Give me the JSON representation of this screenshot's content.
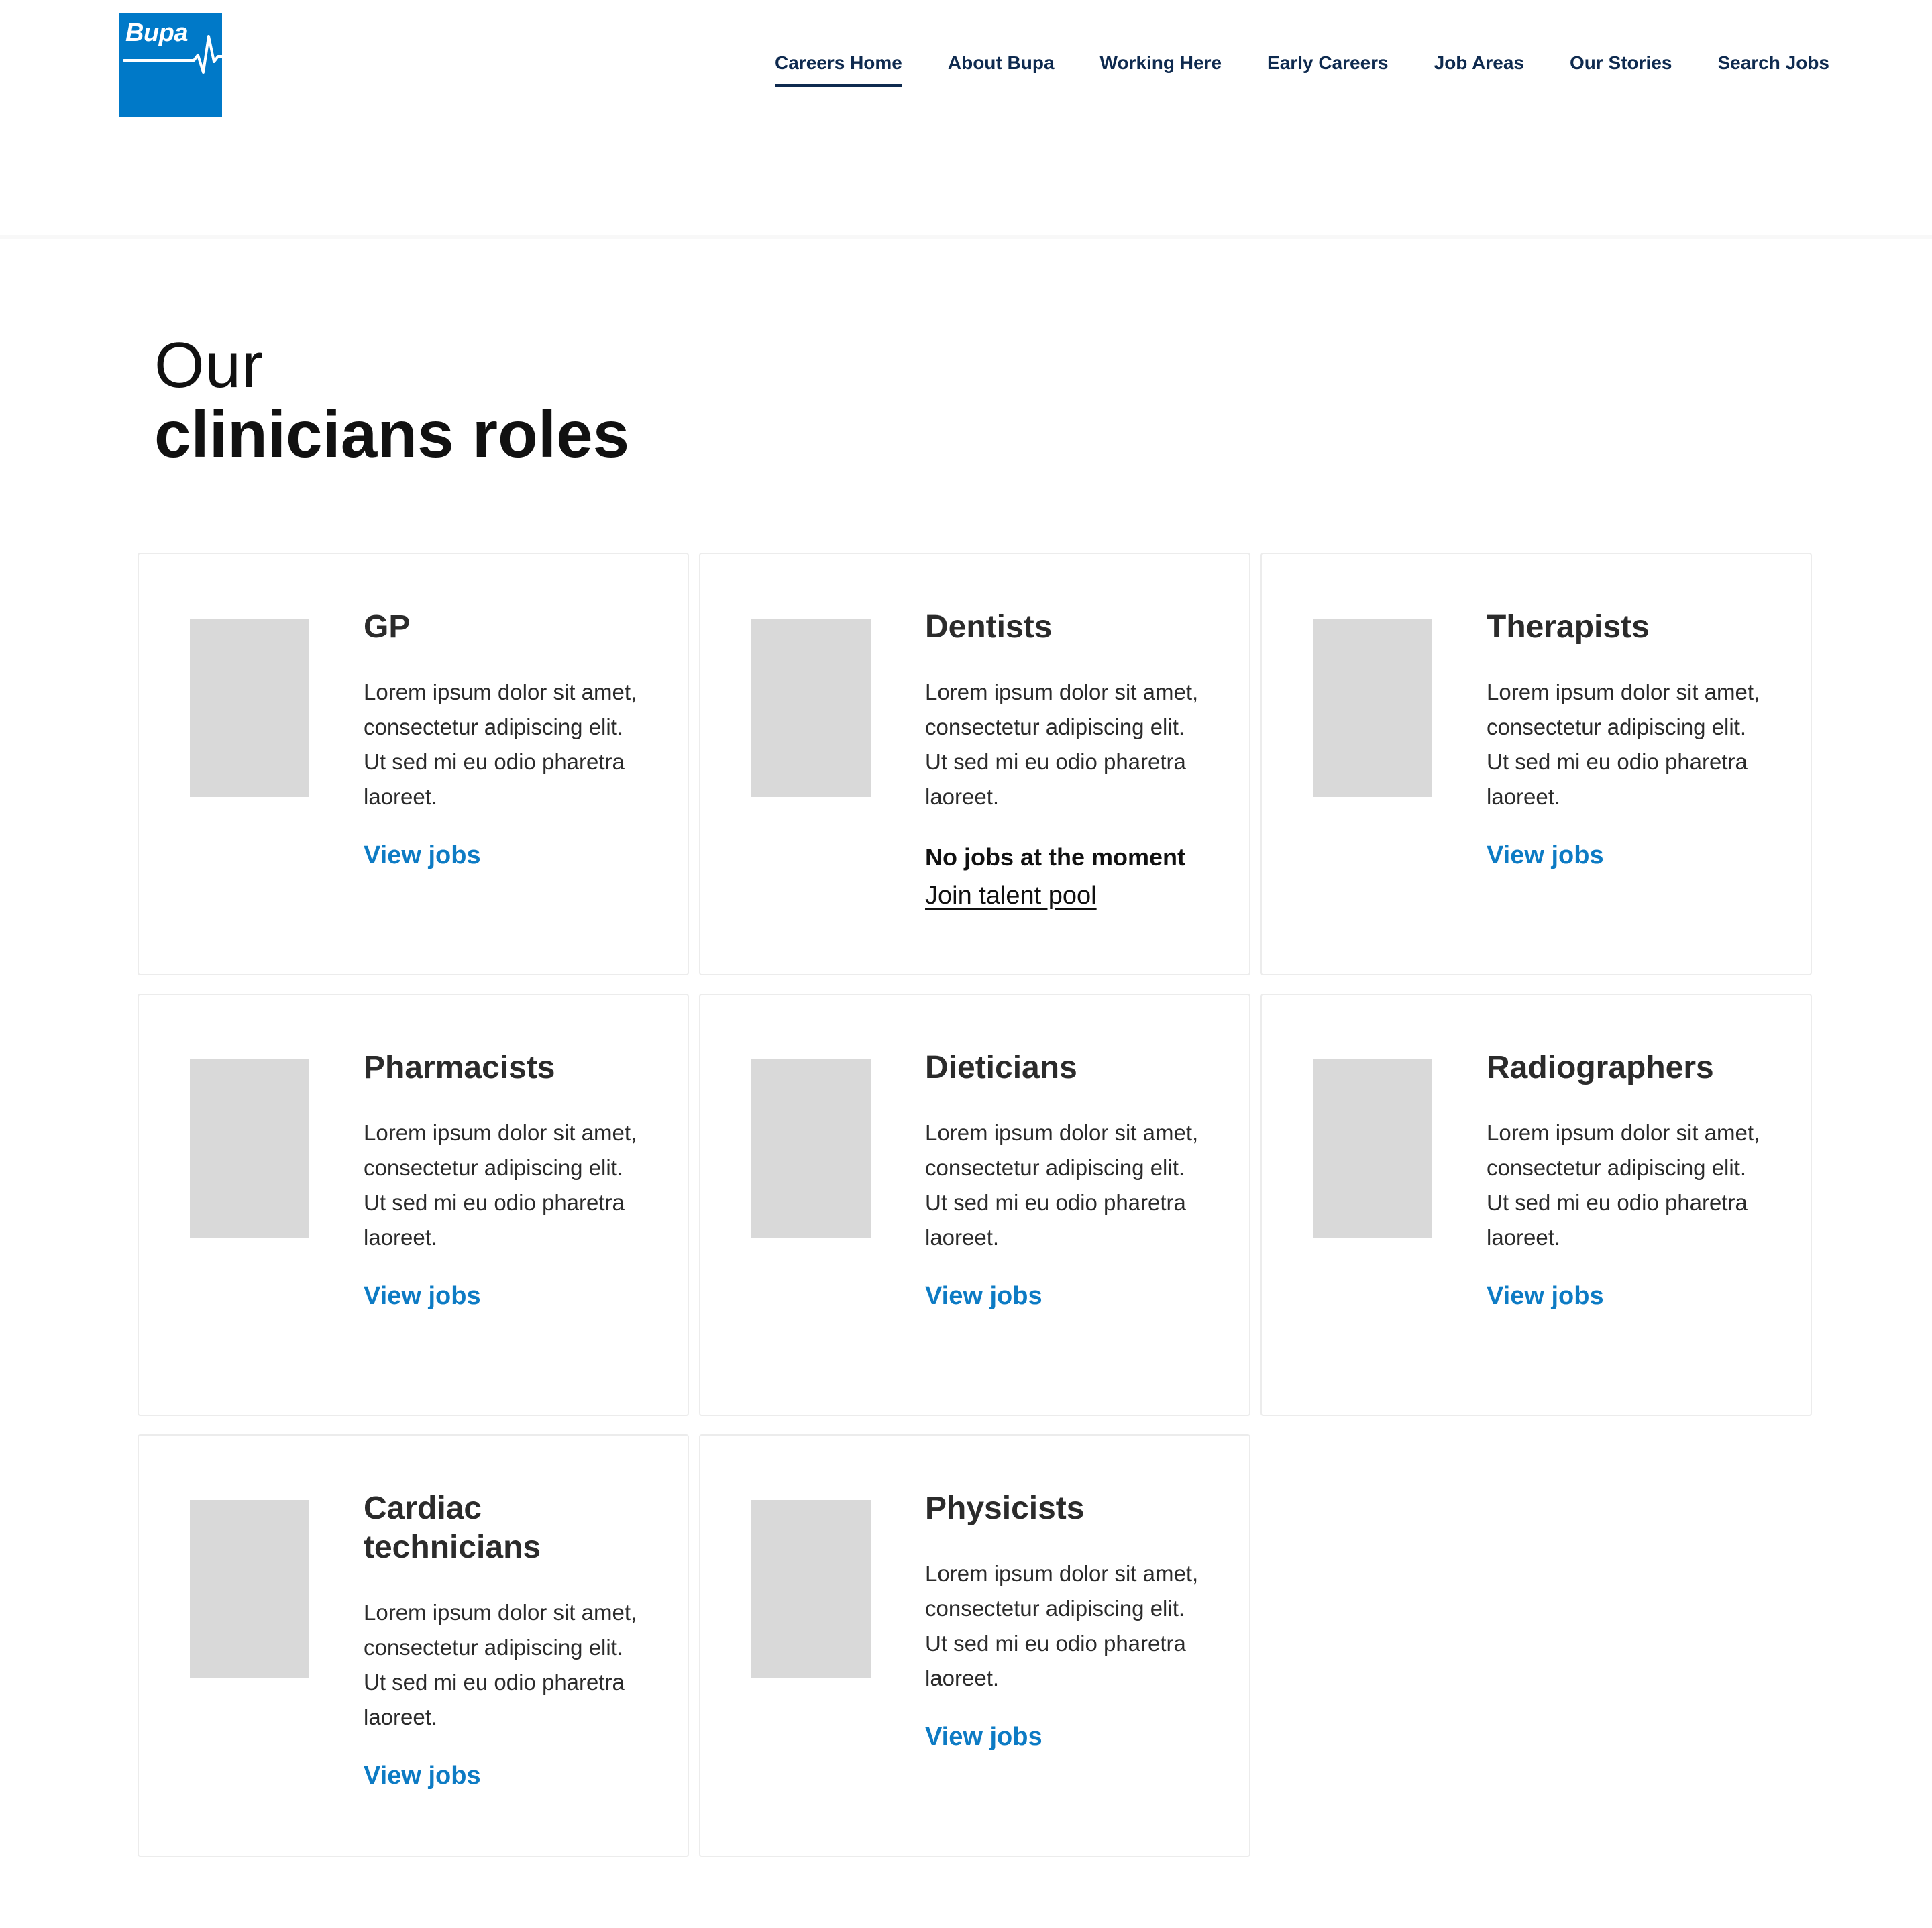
{
  "logo": {
    "text": "Bupa",
    "color": "#0079c8"
  },
  "nav": {
    "items": [
      {
        "label": "Careers Home",
        "active": true
      },
      {
        "label": "About Bupa"
      },
      {
        "label": "Working Here"
      },
      {
        "label": "Early Careers"
      },
      {
        "label": "Job Areas"
      },
      {
        "label": "Our Stories"
      },
      {
        "label": "Search Jobs"
      }
    ]
  },
  "page_title": {
    "line1": "Our",
    "line2": "clinicians roles"
  },
  "cards": [
    {
      "title": "GP",
      "description": "Lorem ipsum dolor sit amet, consectetur adipiscing elit. Ut sed mi eu odio pharetra laoreet.",
      "link": "View jobs"
    },
    {
      "title": "Dentists",
      "description": "Lorem ipsum dolor sit amet, consectetur adipiscing elit. Ut sed mi eu odio pharetra laoreet.",
      "no_jobs": "No jobs at the moment",
      "talent_link": "Join talent pool"
    },
    {
      "title": "Therapists",
      "description": "Lorem ipsum dolor sit amet, consectetur adipiscing elit. Ut sed mi eu odio pharetra laoreet.",
      "link": "View jobs"
    },
    {
      "title": "Pharmacists",
      "description": "Lorem ipsum dolor sit amet, consectetur adipiscing elit. Ut sed mi eu odio pharetra laoreet.",
      "link": "View jobs"
    },
    {
      "title": "Dieticians",
      "description": "Lorem ipsum dolor sit amet, consectetur adipiscing elit. Ut sed mi eu odio pharetra laoreet.",
      "link": "View jobs"
    },
    {
      "title": "Radiographers",
      "description": "Lorem ipsum dolor sit amet, consectetur adipiscing elit. Ut sed mi eu odio pharetra laoreet.",
      "link": "View jobs"
    },
    {
      "title": "Cardiac technicians",
      "description": "Lorem ipsum dolor sit amet, consectetur adipiscing elit. Ut sed mi eu odio pharetra laoreet.",
      "link": "View jobs"
    },
    {
      "title": "Physicists",
      "description": "Lorem ipsum dolor sit amet, consectetur adipiscing elit. Ut sed mi eu odio pharetra laoreet.",
      "link": "View jobs"
    }
  ],
  "colors": {
    "brand_blue": "#0079c8",
    "nav_text": "#0e2a4f",
    "link_blue": "#0d7bc4",
    "placeholder_grey": "#d9d9d9"
  }
}
